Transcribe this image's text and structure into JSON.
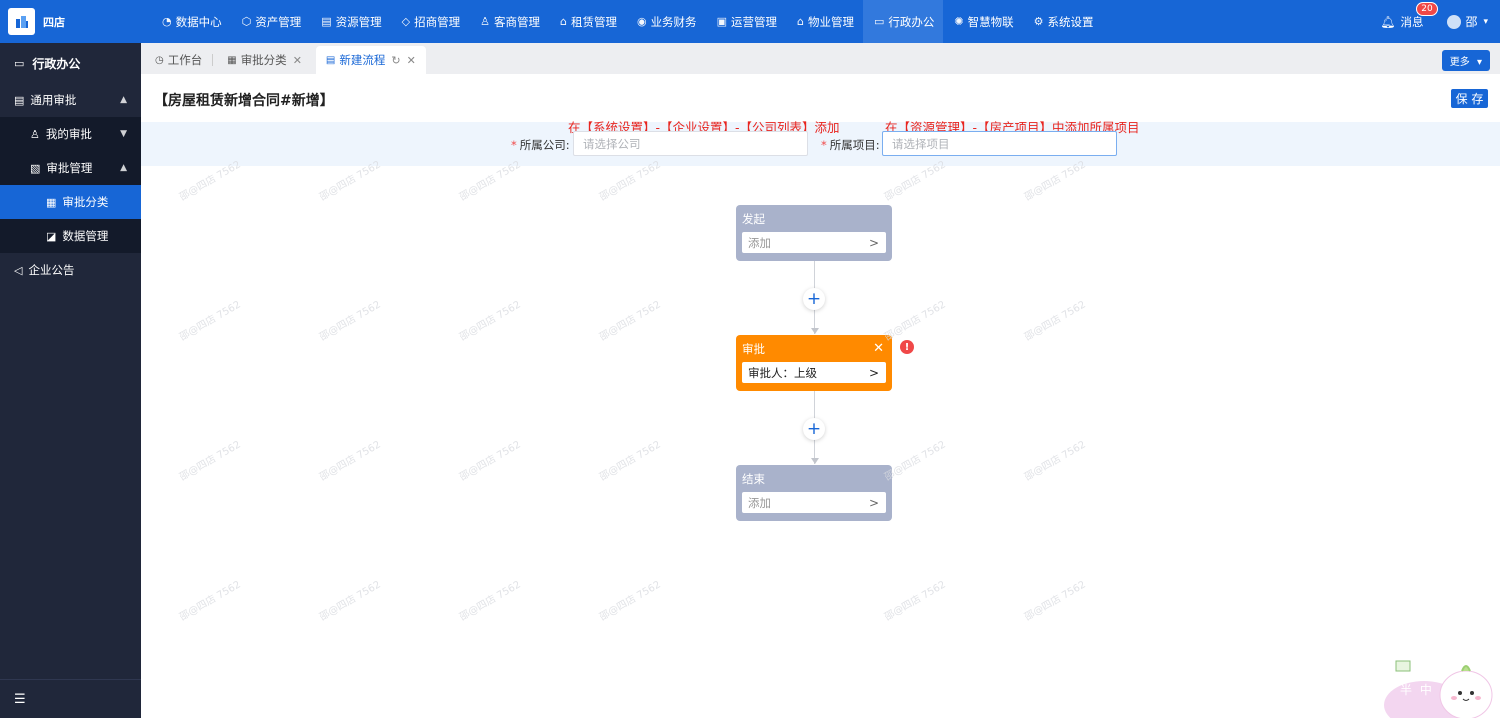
{
  "app": {
    "logo_text": "四店"
  },
  "topnav": [
    {
      "icon": "◔",
      "label": "数据中心",
      "active": false
    },
    {
      "icon": "⬡",
      "label": "资产管理",
      "active": false
    },
    {
      "icon": "▤",
      "label": "资源管理",
      "active": false
    },
    {
      "icon": "◇",
      "label": "招商管理",
      "active": false
    },
    {
      "icon": "♙",
      "label": "客商管理",
      "active": false
    },
    {
      "icon": "⌂",
      "label": "租赁管理",
      "active": false
    },
    {
      "icon": "◉",
      "label": "业务财务",
      "active": false
    },
    {
      "icon": "▣",
      "label": "运营管理",
      "active": false
    },
    {
      "icon": "⌂",
      "label": "物业管理",
      "active": false
    },
    {
      "icon": "▭",
      "label": "行政办公",
      "active": true
    },
    {
      "icon": "✺",
      "label": "智慧物联",
      "active": false
    },
    {
      "icon": "⚙",
      "label": "系统设置",
      "active": false
    }
  ],
  "topright": {
    "message_label": "消息",
    "message_count": "20",
    "user_name": "邵"
  },
  "sidebar": {
    "header": "行政办公",
    "group1": "通用审批",
    "my_approval": "我的审批",
    "approval_manage": "审批管理",
    "approval_category": "审批分类",
    "data_manage": "数据管理",
    "notice": "企业公告"
  },
  "tabs": [
    {
      "label": "工作台"
    },
    {
      "label": "审批分类"
    },
    {
      "label": "新建流程"
    }
  ],
  "tabbar": {
    "more_label": "更多"
  },
  "page": {
    "title": "【房屋租赁新增合同#新增】",
    "save_label": "保 存",
    "hint_company": "在【系统设置】-【企业设置】-【公司列表】添加",
    "hint_project": "在【资源管理】-【房产项目】中添加所属项目",
    "company_label": "所属公司:",
    "company_placeholder": "请选择公司",
    "project_label": "所属项目:",
    "project_placeholder": "请选择项目"
  },
  "flow": {
    "start": {
      "title": "发起",
      "body": "添加"
    },
    "approve": {
      "title": "审批",
      "body": "审批人：上级"
    },
    "end": {
      "title": "结束",
      "body": "添加"
    },
    "warning": "!"
  },
  "watermark": "邵@四店 7562",
  "mascot_text": "半 中"
}
